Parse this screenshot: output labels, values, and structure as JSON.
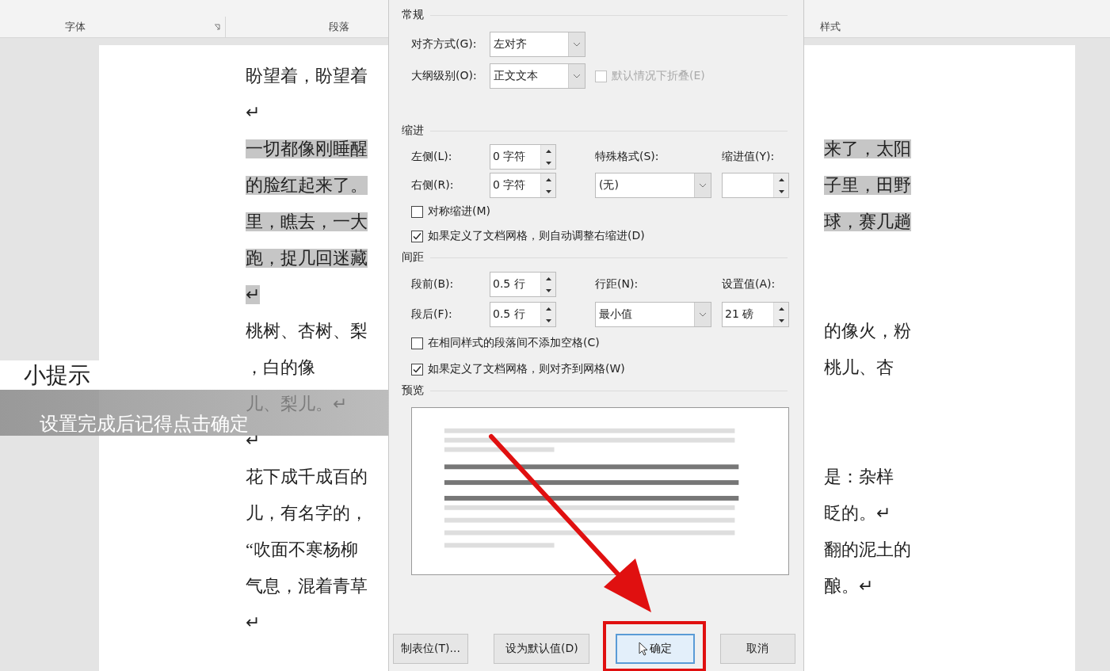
{
  "ribbon": {
    "groups": [
      {
        "label": "字体",
        "launcher": true
      },
      {
        "label": "段落"
      },
      {
        "label": "样式"
      }
    ]
  },
  "document": {
    "lines": [
      {
        "left": "盼望着，盼望着",
        "selected": false
      },
      {
        "left": "↵",
        "selected": false
      },
      {
        "left": "一切都像刚睡醒",
        "right": "来了，太阳",
        "selected": true
      },
      {
        "left": "的脸红起来了。",
        "right": "子里，田野",
        "selected": true
      },
      {
        "left": "里，瞧去，一大",
        "right": "球，赛几趟",
        "selected": true
      },
      {
        "left": "跑，捉几回迷藏",
        "selected": true
      },
      {
        "left": "↵",
        "selected": true
      },
      {
        "left": "桃树、杏树、梨",
        "right": "的像火，粉",
        "selected": false
      },
      {
        "left": "，白的像",
        "right": "桃儿、杏",
        "selected": false
      },
      {
        "left": "儿、梨儿。↵",
        "selected": false
      },
      {
        "left": "↵",
        "selected": false
      },
      {
        "left": "花下成千成百的",
        "right": "是：杂样",
        "selected": false
      },
      {
        "left": "儿，有名字的，",
        "right": "眨的。↵",
        "selected": false
      },
      {
        "left": "“吹面不寒杨柳",
        "right": "翻的泥土的",
        "selected": false
      },
      {
        "left": "气息，混着青草",
        "right": "酿。↵",
        "selected": false
      },
      {
        "left": "↵",
        "selected": false
      }
    ]
  },
  "dialog": {
    "general": {
      "title": "常规",
      "alignment": {
        "label": "对齐方式(G):",
        "value": "左对齐"
      },
      "outline": {
        "label": "大纲级别(O):",
        "value": "正文文本"
      },
      "collapse": {
        "label": "默认情况下折叠(E)",
        "checked": false,
        "disabled": true
      }
    },
    "indent": {
      "title": "缩进",
      "left": {
        "label": "左侧(L):",
        "value": "0 字符"
      },
      "right": {
        "label": "右侧(R):",
        "value": "0 字符"
      },
      "special": {
        "label": "特殊格式(S):",
        "value": "(无)"
      },
      "by": {
        "label": "缩进值(Y):"
      },
      "mirror": {
        "label": "对称缩进(M)",
        "checked": false,
        "disabled": false
      },
      "auto_adjust": {
        "label": "如果定义了文档网格，则自动调整右缩进(D)",
        "checked": true,
        "disabled": false
      }
    },
    "spacing": {
      "title": "间距",
      "before": {
        "label": "段前(B):",
        "value": "0.5 行"
      },
      "after": {
        "label": "段后(F):",
        "value": "0.5 行"
      },
      "line": {
        "label": "行距(N):",
        "value": "最小值"
      },
      "at": {
        "label": "设置值(A):",
        "value": "21 磅"
      },
      "no_space": {
        "label": "在相同样式的段落间不添加空格(C)",
        "checked": false,
        "disabled": false
      },
      "snap": {
        "label": "如果定义了文档网格，则对齐到网格(W)",
        "checked": true,
        "disabled": false
      }
    },
    "preview": {
      "title": "预览"
    },
    "buttons": [
      {
        "label": "制表位(T)...",
        "focused": false
      },
      {
        "label": "设为默认值(D)",
        "focused": false
      },
      {
        "label": "确定",
        "focused": true,
        "hovered": true,
        "highlighted": true
      },
      {
        "label": "取消",
        "focused": false
      }
    ]
  },
  "tip": {
    "title": "小提示",
    "text": "设置完成后记得点击确定"
  }
}
